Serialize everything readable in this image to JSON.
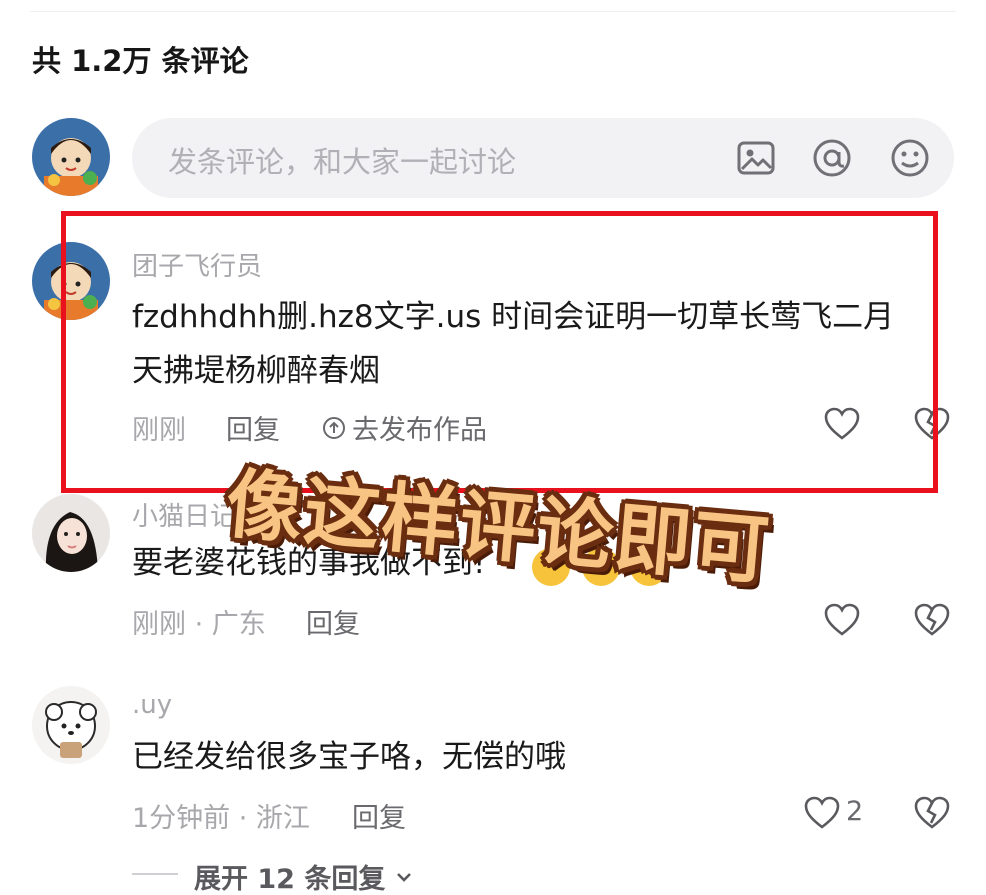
{
  "header": {
    "comment_count": "共 1.2万 条评论"
  },
  "composer": {
    "placeholder": "发条评论，和大家一起讨论",
    "icons": [
      "image-icon",
      "at-icon",
      "emoji-icon"
    ]
  },
  "comments": [
    {
      "username": "团子飞行员",
      "text_line1": "fzdhhdhh删.hz8文字.us 时间会证明一切草长莺飞二月",
      "text_line2": "天拂堤杨柳醉春烟",
      "time": "刚刚",
      "reply": "回复",
      "publish": "去发布作品"
    },
    {
      "username": "小猫日记",
      "text": "要老婆花钱的事我做不到!",
      "time": "刚刚 · 广东",
      "reply": "回复"
    },
    {
      "username": ".uy",
      "text": "已经发给很多宝子咯，无偿的哦",
      "time": "1分钟前 · 浙江",
      "reply": "回复",
      "likes": "2"
    }
  ],
  "expand": {
    "label": "展开 12 条回复"
  },
  "overlay": {
    "caption": "像这样评论即可"
  },
  "colors": {
    "highlight": "#e8111d",
    "caption_fill": "#f7c483",
    "caption_stroke": "#6a2d10"
  }
}
